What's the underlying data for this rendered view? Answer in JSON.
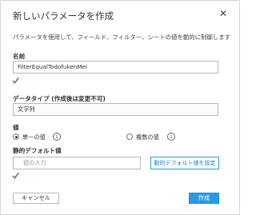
{
  "dialog": {
    "title": "新しいパラメータを作成",
    "description": "パラメータを使用して、フィールド、フィルター、シートの値を動的に制御します"
  },
  "name_section": {
    "label": "名前",
    "value": "FilterEqualTodofukenMei"
  },
  "data_type_section": {
    "label": "データタイプ (作成後は変更不可)",
    "selected": "文字列"
  },
  "values_section": {
    "label": "値",
    "options": [
      {
        "label": "単一の値",
        "selected": true
      },
      {
        "label": "複数の値",
        "selected": false
      }
    ]
  },
  "static_default_section": {
    "label": "静的デフォルト値",
    "placeholder": "値の入力",
    "dynamic_button": "動的デフォルト値を設定"
  },
  "footer": {
    "cancel": "キャンセル",
    "create": "作成"
  },
  "colors": {
    "accent": "#2a9ae0",
    "check": "#2e8b3a"
  },
  "icons": [
    "close-icon",
    "checkmark-icon",
    "info-icon"
  ]
}
